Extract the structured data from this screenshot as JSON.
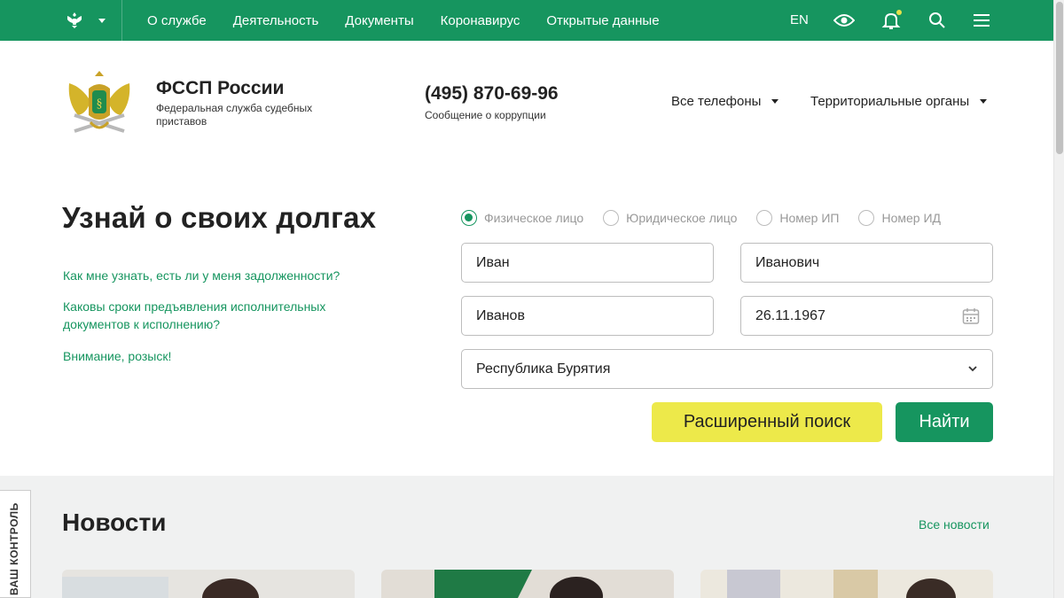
{
  "topbar": {
    "nav": [
      "О службе",
      "Деятельность",
      "Документы",
      "Коронавирус",
      "Открытые данные"
    ],
    "lang": "EN",
    "icons": [
      "emblem-icon",
      "eye-icon",
      "bell-icon",
      "search-icon",
      "menu-icon"
    ]
  },
  "header": {
    "title": "ФССП России",
    "subtitle": "Федеральная служба судебных приставов",
    "phone": "(495) 870-69-96",
    "phone_sub": "Сообщение о коррупции",
    "phones_dropdown": "Все телефоны",
    "regions_dropdown": "Территориальные органы"
  },
  "search": {
    "title": "Узнай о своих долгах",
    "faq": [
      "Как мне узнать, есть ли у меня задолженности?",
      "Каковы сроки предъявления исполнительных документов к исполнению?",
      "Внимание, розыск!"
    ],
    "modes": [
      "Физическое лицо",
      "Юридическое лицо",
      "Номер ИП",
      "Номер ИД"
    ],
    "selected_mode": "Физическое лицо",
    "first_name": "Иван",
    "patronymic": "Иванович",
    "last_name": "Иванов",
    "birth_date": "26.11.1967",
    "region": "Республика Бурятия",
    "advanced_button": "Расширенный поиск",
    "find_button": "Найти"
  },
  "news": {
    "title": "Новости",
    "all_link": "Все новости"
  },
  "side_tab": "ВАШ КОНТРОЛЬ",
  "colors": {
    "brand_green": "#16955f",
    "accent_yellow": "#ede94a"
  }
}
